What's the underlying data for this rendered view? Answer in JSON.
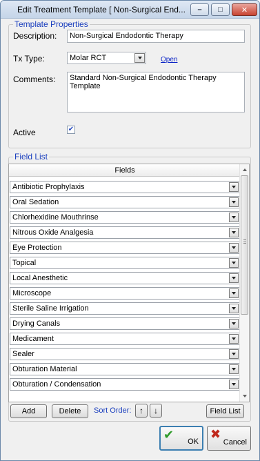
{
  "window": {
    "title": "Edit Treatment Template [ Non-Surgical End...",
    "minimize_glyph": "–",
    "maximize_glyph": "□",
    "close_glyph": "✕"
  },
  "template_properties": {
    "legend": "Template Properties",
    "description_label": "Description:",
    "description_value": "Non-Surgical Endodontic Therapy",
    "tx_type_label": "Tx Type:",
    "tx_type_value": "Molar RCT",
    "open_link": "Open",
    "comments_label": "Comments:",
    "comments_value": "Standard Non-Surgical Endodontic Therapy Template",
    "active_label": "Active",
    "active_checked": true,
    "check_glyph": "✔"
  },
  "field_list": {
    "legend": "Field List",
    "column_header": "Fields",
    "rows": [
      "Antibiotic Prophylaxis",
      "Oral Sedation",
      "Chlorhexidine Mouthrinse",
      "Nitrous Oxide Analgesia",
      "Eye Protection",
      "Topical",
      "Local Anesthetic",
      "Microscope",
      "Sterile Saline Irrigation",
      "Drying Canals",
      "Medicament",
      "Sealer",
      "Obturation Material",
      "Obturation / Condensation"
    ]
  },
  "buttons": {
    "add": "Add",
    "delete": "Delete",
    "sort_order_label": "Sort Order:",
    "sort_up": "↑",
    "sort_down": "↓",
    "field_list": "Field List",
    "ok": "OK",
    "cancel": "Cancel"
  },
  "colors": {
    "legend_blue": "#1b3fbe",
    "ok_check_green": "#2e9a2a",
    "cancel_x_red": "#c0281c"
  },
  "icons": {
    "ok": "check-icon",
    "cancel": "x-icon"
  }
}
